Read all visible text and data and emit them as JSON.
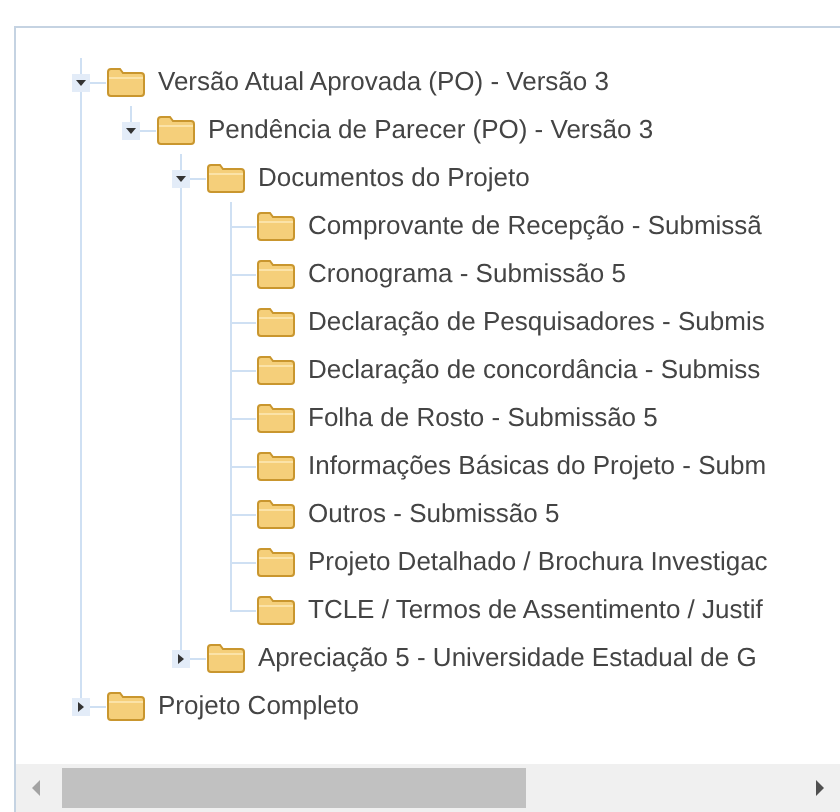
{
  "tree": [
    {
      "label": "Versão Atual Aprovada (PO) - Versão 3",
      "expanded": true,
      "children": [
        {
          "label": "Pendência de Parecer (PO) - Versão 3",
          "expanded": true,
          "children": [
            {
              "label": "Documentos do Projeto",
              "expanded": true,
              "children": [
                {
                  "label": "Comprovante de Recepção - Submissã"
                },
                {
                  "label": "Cronograma - Submissão 5"
                },
                {
                  "label": "Declaração de Pesquisadores - Submis"
                },
                {
                  "label": "Declaração de concordância - Submiss"
                },
                {
                  "label": "Folha de Rosto - Submissão 5"
                },
                {
                  "label": "Informações Básicas do Projeto - Subm"
                },
                {
                  "label": "Outros - Submissão 5"
                },
                {
                  "label": "Projeto Detalhado / Brochura Investigac"
                },
                {
                  "label": "TCLE / Termos de Assentimento / Justif"
                }
              ]
            },
            {
              "label": "Apreciação 5 - Universidade Estadual de G",
              "expanded": false
            }
          ]
        }
      ]
    },
    {
      "label": "Projeto Completo",
      "expanded": false
    }
  ]
}
